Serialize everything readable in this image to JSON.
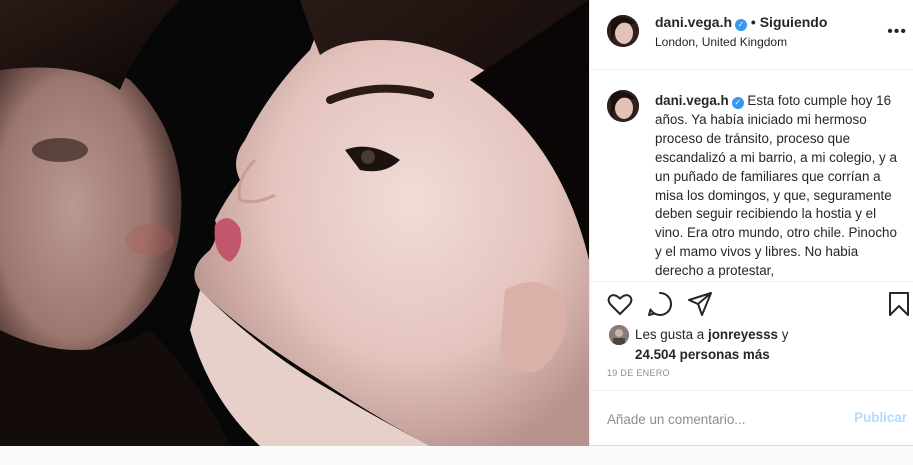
{
  "post": {
    "username": "dani.vega.h",
    "verified_icon": "verified-badge-icon",
    "separator": "•",
    "follow_status": "Siguiendo",
    "location": "London, United Kingdom",
    "more_icon": "more-options-icon"
  },
  "caption": {
    "username": "dani.vega.h",
    "text": "Esta foto cumple hoy 16 años. Ya había iniciado mi hermoso proceso de tránsito, proceso que escandalizó a mi barrio, a mi colegio, y a un puñado de familiares que corrían a misa los domingos, y que, seguramente deben seguir recibiendo la hostia y el vino. Era otro mundo, otro chile. Pinocho y el mamo vivos y libres. No habia derecho a protestar,"
  },
  "actions": {
    "like_icon": "heart-icon",
    "comment_icon": "comment-icon",
    "share_icon": "share-icon",
    "save_icon": "bookmark-icon"
  },
  "likes": {
    "prefix": "Les gusta a",
    "first_user": "jonreyesss",
    "conjunction": "y",
    "count_text": "24.504 personas más"
  },
  "date": "19 DE ENERO",
  "comment": {
    "placeholder": "Añade un comentario...",
    "publish_label": "Publicar"
  },
  "colors": {
    "accent_blue": "#3897f0",
    "publish_disabled": "#b3dbff",
    "text": "#262626",
    "muted": "#8e8e8e"
  }
}
